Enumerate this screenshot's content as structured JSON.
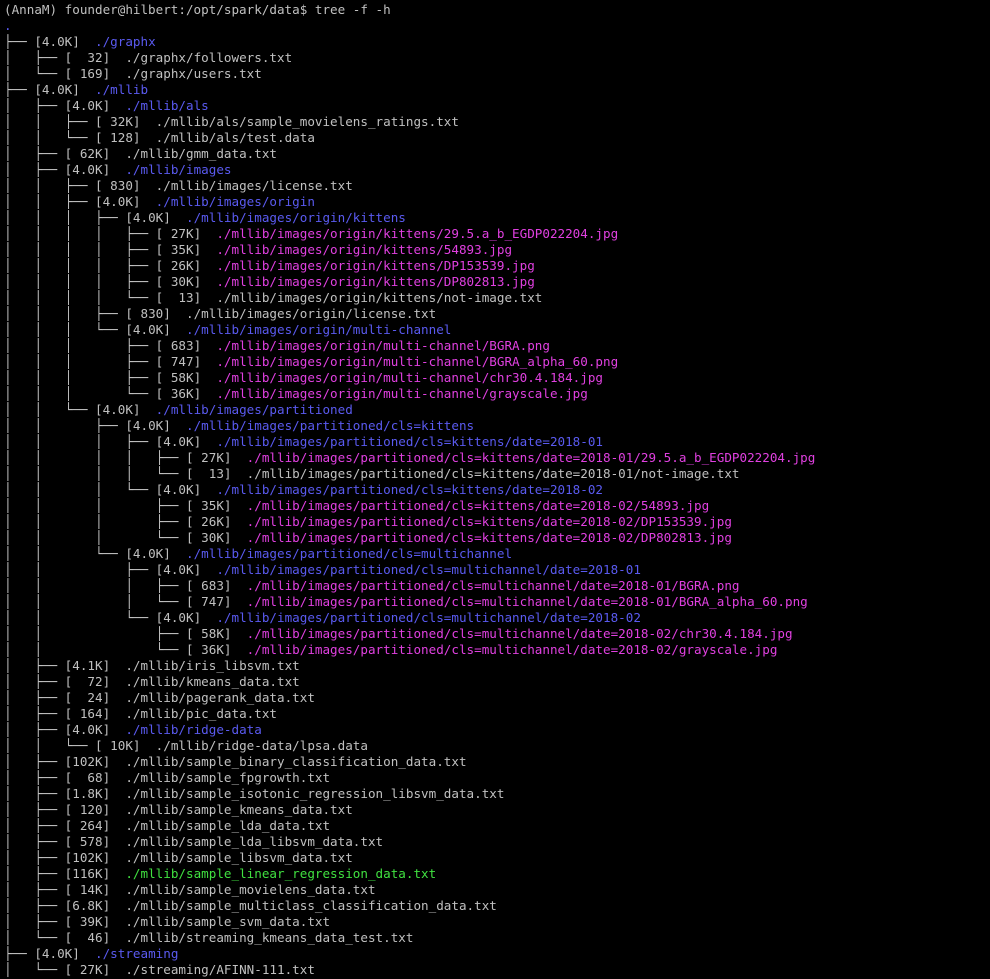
{
  "prompt": "(AnnaM) founder@hilbert:/opt/spark/data$ tree -f -h",
  "colors": {
    "background": "#000000",
    "text": "#c0c0c0",
    "directory": "#5a5af0",
    "image": "#e040e0",
    "executable": "#40e040"
  },
  "lines": [
    {
      "prefix": ".",
      "size": "",
      "name": "",
      "type": "dir"
    },
    {
      "prefix": "├── ",
      "size": "[4.0K]",
      "name": "./graphx",
      "type": "dir"
    },
    {
      "prefix": "│   ├── ",
      "size": "[  32]",
      "name": "./graphx/followers.txt",
      "type": "txt"
    },
    {
      "prefix": "│   └── ",
      "size": "[ 169]",
      "name": "./graphx/users.txt",
      "type": "txt"
    },
    {
      "prefix": "├── ",
      "size": "[4.0K]",
      "name": "./mllib",
      "type": "dir"
    },
    {
      "prefix": "│   ├── ",
      "size": "[4.0K]",
      "name": "./mllib/als",
      "type": "dir"
    },
    {
      "prefix": "│   │   ├── ",
      "size": "[ 32K]",
      "name": "./mllib/als/sample_movielens_ratings.txt",
      "type": "txt"
    },
    {
      "prefix": "│   │   └── ",
      "size": "[ 128]",
      "name": "./mllib/als/test.data",
      "type": "txt"
    },
    {
      "prefix": "│   ├── ",
      "size": "[ 62K]",
      "name": "./mllib/gmm_data.txt",
      "type": "txt"
    },
    {
      "prefix": "│   ├── ",
      "size": "[4.0K]",
      "name": "./mllib/images",
      "type": "dir"
    },
    {
      "prefix": "│   │   ├── ",
      "size": "[ 830]",
      "name": "./mllib/images/license.txt",
      "type": "txt"
    },
    {
      "prefix": "│   │   ├── ",
      "size": "[4.0K]",
      "name": "./mllib/images/origin",
      "type": "dir"
    },
    {
      "prefix": "│   │   │   ├── ",
      "size": "[4.0K]",
      "name": "./mllib/images/origin/kittens",
      "type": "dir"
    },
    {
      "prefix": "│   │   │   │   ├── ",
      "size": "[ 27K]",
      "name": "./mllib/images/origin/kittens/29.5.a_b_EGDP022204.jpg",
      "type": "img"
    },
    {
      "prefix": "│   │   │   │   ├── ",
      "size": "[ 35K]",
      "name": "./mllib/images/origin/kittens/54893.jpg",
      "type": "img"
    },
    {
      "prefix": "│   │   │   │   ├── ",
      "size": "[ 26K]",
      "name": "./mllib/images/origin/kittens/DP153539.jpg",
      "type": "img"
    },
    {
      "prefix": "│   │   │   │   ├── ",
      "size": "[ 30K]",
      "name": "./mllib/images/origin/kittens/DP802813.jpg",
      "type": "img"
    },
    {
      "prefix": "│   │   │   │   └── ",
      "size": "[  13]",
      "name": "./mllib/images/origin/kittens/not-image.txt",
      "type": "txt"
    },
    {
      "prefix": "│   │   │   ├── ",
      "size": "[ 830]",
      "name": "./mllib/images/origin/license.txt",
      "type": "txt"
    },
    {
      "prefix": "│   │   │   └── ",
      "size": "[4.0K]",
      "name": "./mllib/images/origin/multi-channel",
      "type": "dir"
    },
    {
      "prefix": "│   │   │       ├── ",
      "size": "[ 683]",
      "name": "./mllib/images/origin/multi-channel/BGRA.png",
      "type": "img"
    },
    {
      "prefix": "│   │   │       ├── ",
      "size": "[ 747]",
      "name": "./mllib/images/origin/multi-channel/BGRA_alpha_60.png",
      "type": "img"
    },
    {
      "prefix": "│   │   │       ├── ",
      "size": "[ 58K]",
      "name": "./mllib/images/origin/multi-channel/chr30.4.184.jpg",
      "type": "img"
    },
    {
      "prefix": "│   │   │       └── ",
      "size": "[ 36K]",
      "name": "./mllib/images/origin/multi-channel/grayscale.jpg",
      "type": "img"
    },
    {
      "prefix": "│   │   └── ",
      "size": "[4.0K]",
      "name": "./mllib/images/partitioned",
      "type": "dir"
    },
    {
      "prefix": "│   │       ├── ",
      "size": "[4.0K]",
      "name": "./mllib/images/partitioned/cls=kittens",
      "type": "dir"
    },
    {
      "prefix": "│   │       │   ├── ",
      "size": "[4.0K]",
      "name": "./mllib/images/partitioned/cls=kittens/date=2018-01",
      "type": "dir"
    },
    {
      "prefix": "│   │       │   │   ├── ",
      "size": "[ 27K]",
      "name": "./mllib/images/partitioned/cls=kittens/date=2018-01/29.5.a_b_EGDP022204.jpg",
      "type": "img"
    },
    {
      "prefix": "│   │       │   │   └── ",
      "size": "[  13]",
      "name": "./mllib/images/partitioned/cls=kittens/date=2018-01/not-image.txt",
      "type": "txt"
    },
    {
      "prefix": "│   │       │   └── ",
      "size": "[4.0K]",
      "name": "./mllib/images/partitioned/cls=kittens/date=2018-02",
      "type": "dir"
    },
    {
      "prefix": "│   │       │       ├── ",
      "size": "[ 35K]",
      "name": "./mllib/images/partitioned/cls=kittens/date=2018-02/54893.jpg",
      "type": "img"
    },
    {
      "prefix": "│   │       │       ├── ",
      "size": "[ 26K]",
      "name": "./mllib/images/partitioned/cls=kittens/date=2018-02/DP153539.jpg",
      "type": "img"
    },
    {
      "prefix": "│   │       │       └── ",
      "size": "[ 30K]",
      "name": "./mllib/images/partitioned/cls=kittens/date=2018-02/DP802813.jpg",
      "type": "img"
    },
    {
      "prefix": "│   │       └── ",
      "size": "[4.0K]",
      "name": "./mllib/images/partitioned/cls=multichannel",
      "type": "dir"
    },
    {
      "prefix": "│   │           ├── ",
      "size": "[4.0K]",
      "name": "./mllib/images/partitioned/cls=multichannel/date=2018-01",
      "type": "dir"
    },
    {
      "prefix": "│   │           │   ├── ",
      "size": "[ 683]",
      "name": "./mllib/images/partitioned/cls=multichannel/date=2018-01/BGRA.png",
      "type": "img"
    },
    {
      "prefix": "│   │           │   └── ",
      "size": "[ 747]",
      "name": "./mllib/images/partitioned/cls=multichannel/date=2018-01/BGRA_alpha_60.png",
      "type": "img"
    },
    {
      "prefix": "│   │           └── ",
      "size": "[4.0K]",
      "name": "./mllib/images/partitioned/cls=multichannel/date=2018-02",
      "type": "dir"
    },
    {
      "prefix": "│   │               ├── ",
      "size": "[ 58K]",
      "name": "./mllib/images/partitioned/cls=multichannel/date=2018-02/chr30.4.184.jpg",
      "type": "img"
    },
    {
      "prefix": "│   │               └── ",
      "size": "[ 36K]",
      "name": "./mllib/images/partitioned/cls=multichannel/date=2018-02/grayscale.jpg",
      "type": "img"
    },
    {
      "prefix": "│   ├── ",
      "size": "[4.1K]",
      "name": "./mllib/iris_libsvm.txt",
      "type": "txt"
    },
    {
      "prefix": "│   ├── ",
      "size": "[  72]",
      "name": "./mllib/kmeans_data.txt",
      "type": "txt"
    },
    {
      "prefix": "│   ├── ",
      "size": "[  24]",
      "name": "./mllib/pagerank_data.txt",
      "type": "txt"
    },
    {
      "prefix": "│   ├── ",
      "size": "[ 164]",
      "name": "./mllib/pic_data.txt",
      "type": "txt"
    },
    {
      "prefix": "│   ├── ",
      "size": "[4.0K]",
      "name": "./mllib/ridge-data",
      "type": "dir"
    },
    {
      "prefix": "│   │   └── ",
      "size": "[ 10K]",
      "name": "./mllib/ridge-data/lpsa.data",
      "type": "txt"
    },
    {
      "prefix": "│   ├── ",
      "size": "[102K]",
      "name": "./mllib/sample_binary_classification_data.txt",
      "type": "txt"
    },
    {
      "prefix": "│   ├── ",
      "size": "[  68]",
      "name": "./mllib/sample_fpgrowth.txt",
      "type": "txt"
    },
    {
      "prefix": "│   ├── ",
      "size": "[1.8K]",
      "name": "./mllib/sample_isotonic_regression_libsvm_data.txt",
      "type": "txt"
    },
    {
      "prefix": "│   ├── ",
      "size": "[ 120]",
      "name": "./mllib/sample_kmeans_data.txt",
      "type": "txt"
    },
    {
      "prefix": "│   ├── ",
      "size": "[ 264]",
      "name": "./mllib/sample_lda_data.txt",
      "type": "txt"
    },
    {
      "prefix": "│   ├── ",
      "size": "[ 578]",
      "name": "./mllib/sample_lda_libsvm_data.txt",
      "type": "txt"
    },
    {
      "prefix": "│   ├── ",
      "size": "[102K]",
      "name": "./mllib/sample_libsvm_data.txt",
      "type": "txt"
    },
    {
      "prefix": "│   ├── ",
      "size": "[116K]",
      "name": "./mllib/sample_linear_regression_data.txt",
      "type": "exe"
    },
    {
      "prefix": "│   ├── ",
      "size": "[ 14K]",
      "name": "./mllib/sample_movielens_data.txt",
      "type": "txt"
    },
    {
      "prefix": "│   ├── ",
      "size": "[6.8K]",
      "name": "./mllib/sample_multiclass_classification_data.txt",
      "type": "txt"
    },
    {
      "prefix": "│   ├── ",
      "size": "[ 39K]",
      "name": "./mllib/sample_svm_data.txt",
      "type": "txt"
    },
    {
      "prefix": "│   └── ",
      "size": "[  46]",
      "name": "./mllib/streaming_kmeans_data_test.txt",
      "type": "txt"
    },
    {
      "prefix": "├── ",
      "size": "[4.0K]",
      "name": "./streaming",
      "type": "dir"
    },
    {
      "prefix": "│   └── ",
      "size": "[ 27K]",
      "name": "./streaming/AFINN-111.txt",
      "type": "txt"
    }
  ]
}
